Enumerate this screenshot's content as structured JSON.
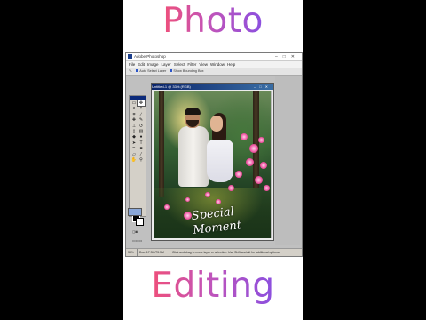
{
  "overlay": {
    "top_word": "Photo",
    "bottom_word": "Editing"
  },
  "app": {
    "window_title": "Adobe Photoshop",
    "menu": [
      "File",
      "Edit",
      "Image",
      "Layer",
      "Select",
      "Filter",
      "View",
      "Window",
      "Help"
    ],
    "options": {
      "auto_select_label": "Auto Select Layer",
      "show_bounding_label": "Show Bounding Box"
    },
    "document": {
      "title": "Untitled-1 @ 33% (RGB)",
      "overlay_text": "Special Moment"
    },
    "status": {
      "zoom": "33%",
      "doc_size": "Doc: 17.9M/73.3M",
      "hint": "Click and drag to move layer or selection. Use Shift and Alt for additional options."
    }
  },
  "colors": {
    "gradient_start": "#ef4f7a",
    "gradient_end": "#8a4fe0",
    "titlebar": "#0a246a"
  }
}
